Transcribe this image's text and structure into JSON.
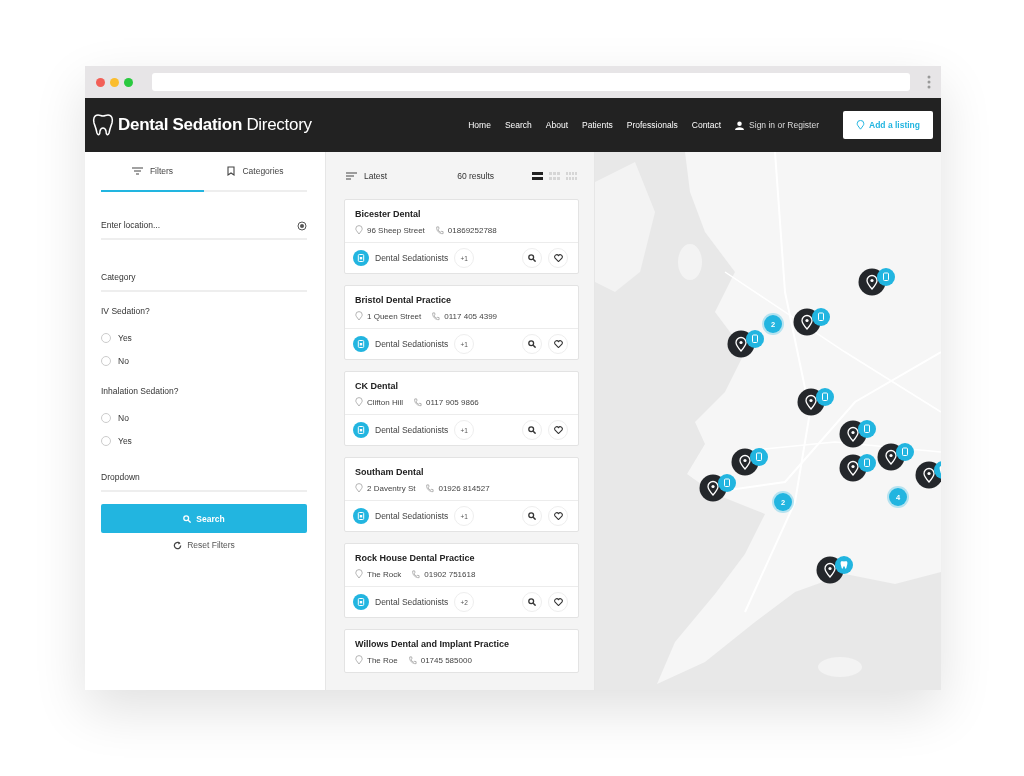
{
  "header": {
    "logo_bold": "Dental Sedation",
    "logo_light": "Directory",
    "nav": [
      "Home",
      "Search",
      "About",
      "Patients",
      "Professionals",
      "Contact"
    ],
    "account": "Sign in or Register",
    "cta": "Add a listing"
  },
  "filters": {
    "tabs": [
      {
        "label": "Filters",
        "selected": true
      },
      {
        "label": "Categories",
        "selected": false
      }
    ],
    "location": {
      "placeholder": "Enter location..."
    },
    "category": {
      "placeholder": "Category"
    },
    "questions": [
      {
        "label": "IV Sedation?",
        "options": [
          {
            "label": "Yes",
            "selected": false
          },
          {
            "label": "No",
            "selected": false
          }
        ]
      },
      {
        "label": "Inhalation Sedation?",
        "options": [
          {
            "label": "No",
            "selected": false
          },
          {
            "label": "Yes",
            "selected": false
          }
        ]
      }
    ],
    "dropdown": {
      "placeholder": "Dropdown"
    },
    "search": "Search",
    "reset": "Reset Filters"
  },
  "results": {
    "sort": "Latest",
    "count": "60 results",
    "views": [
      {
        "kind": "list",
        "selected": true
      },
      {
        "kind": "grid",
        "selected": false
      },
      {
        "kind": "dense",
        "selected": false
      }
    ],
    "listings": [
      {
        "name": "Bicester Dental",
        "address": "96 Sheep Street",
        "phone": "01869252788",
        "category": "Dental Sedationists",
        "extra": "+1"
      },
      {
        "name": "Bristol Dental Practice",
        "address": "1 Queen Street",
        "phone": "0117 405 4399",
        "category": "Dental Sedationists",
        "extra": "+1"
      },
      {
        "name": "CK Dental",
        "address": "Clifton Hill",
        "phone": "0117 905 9866",
        "category": "Dental Sedationists",
        "extra": "+1"
      },
      {
        "name": "Southam Dental",
        "address": "2 Daventry St",
        "phone": "01926 814527",
        "category": "Dental Sedationists",
        "extra": "+1"
      },
      {
        "name": "Rock House Dental Practice",
        "address": "The Rock",
        "phone": "01902 751618",
        "category": "Dental Sedationists",
        "extra": "+2"
      },
      {
        "name": "Willows Dental and Implant Practice",
        "address": "The Roe",
        "phone": "01745 585000"
      }
    ]
  },
  "map": {
    "kind": "picture",
    "clusters": [
      {
        "count": "2"
      },
      {
        "count": "2"
      },
      {
        "count": "4"
      }
    ]
  }
}
